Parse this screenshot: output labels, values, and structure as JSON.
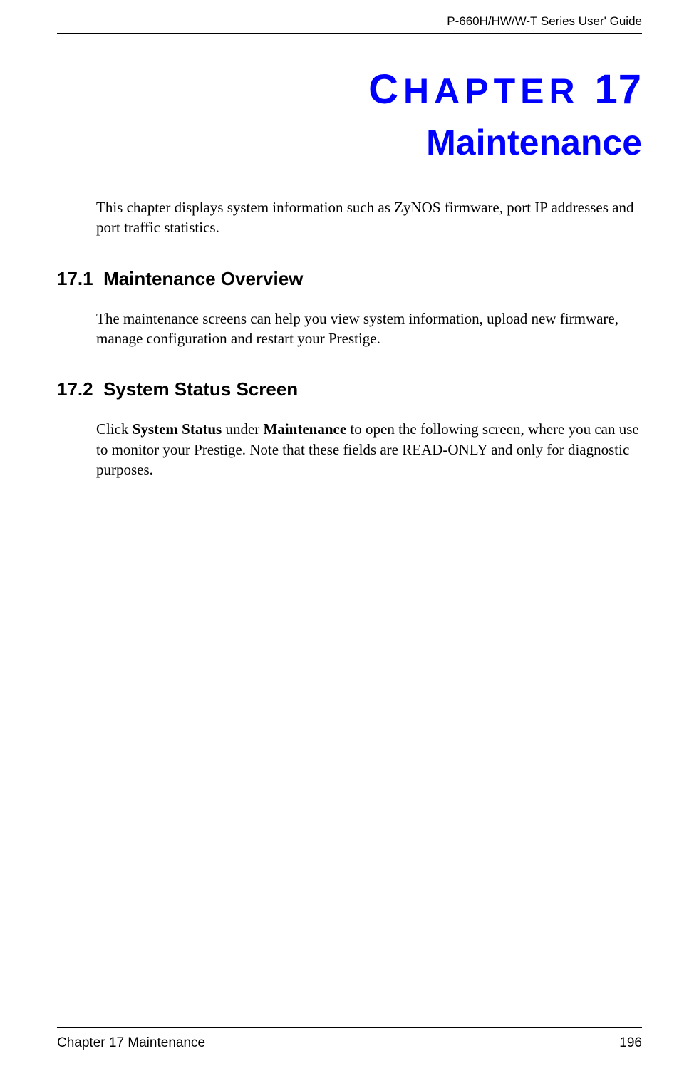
{
  "header": {
    "guide_title": "P-660H/HW/W-T Series User' Guide"
  },
  "chapter": {
    "label_prefix": "C",
    "label_rest": "HAPTER",
    "number": "17",
    "title": "Maintenance",
    "intro": "This chapter displays system information such as ZyNOS firmware, port IP addresses and port traffic statistics."
  },
  "sections": [
    {
      "number": "17.1",
      "title": "Maintenance Overview",
      "para_plain": "The maintenance screens can help you view system information, upload new firmware, manage configuration and restart your Prestige."
    },
    {
      "number": "17.2",
      "title": "System Status Screen",
      "para_parts": {
        "p1": "Click ",
        "b1": "System Status",
        "p2": " under ",
        "b2": "Maintenance",
        "p3": " to open the following screen, where you can use to monitor your Prestige. Note that these fields are READ-ONLY and only for diagnostic purposes."
      }
    }
  ],
  "footer": {
    "chapter_ref": "Chapter 17 Maintenance",
    "page_number": "196"
  }
}
